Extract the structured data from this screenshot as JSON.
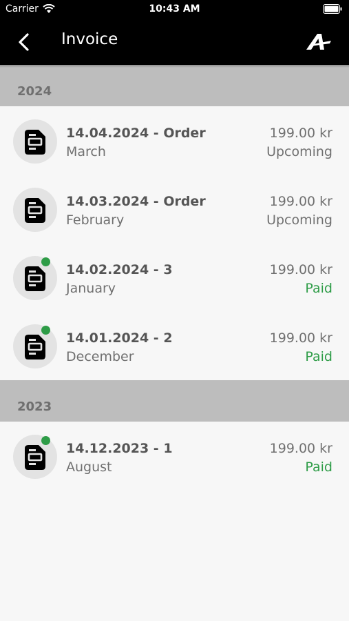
{
  "status_bar": {
    "carrier": "Carrier",
    "time": "10:43 AM"
  },
  "header": {
    "title": "Invoice"
  },
  "colors": {
    "paid": "#2e9c47",
    "upcoming": "#707070"
  },
  "sections": [
    {
      "year": "2024",
      "rows": [
        {
          "title": "14.04.2024 - Order",
          "subtitle": "March",
          "amount": "199.00 kr",
          "status": "Upcoming",
          "dot": false
        },
        {
          "title": "14.03.2024 - Order",
          "subtitle": "February",
          "amount": "199.00 kr",
          "status": "Upcoming",
          "dot": false
        },
        {
          "title": "14.02.2024 - 3",
          "subtitle": "January",
          "amount": "199.00 kr",
          "status": "Paid",
          "dot": true
        },
        {
          "title": "14.01.2024 - 2",
          "subtitle": "December",
          "amount": "199.00 kr",
          "status": "Paid",
          "dot": true
        }
      ]
    },
    {
      "year": "2023",
      "rows": [
        {
          "title": "14.12.2023 - 1",
          "subtitle": "August",
          "amount": "199.00 kr",
          "status": "Paid",
          "dot": true
        }
      ]
    }
  ]
}
